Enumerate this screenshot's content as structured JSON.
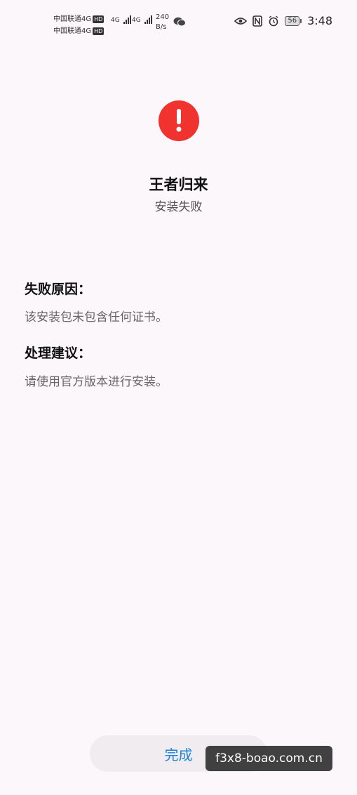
{
  "status_bar": {
    "carrier1": "中国联通4G",
    "carrier2": "中国联通4G",
    "hd_badge": "HD",
    "signal1_label": "4G",
    "signal2_label": "4G",
    "net_speed_value": "240",
    "net_speed_unit": "B/s",
    "battery_level": "56",
    "time": "3:48",
    "icons": [
      "wechat-icon",
      "eye-icon",
      "nfc-icon",
      "alarm-icon",
      "battery-icon"
    ]
  },
  "header": {
    "icon": "alert-icon",
    "icon_color": "#f0332f",
    "app_name": "王者归来",
    "install_status": "安装失败"
  },
  "failure_reason": {
    "title": "失败原因：",
    "text": "该安装包未包含任何证书。"
  },
  "suggestion": {
    "title": "处理建议：",
    "text": "请使用官方版本进行安装。"
  },
  "footer": {
    "done_label": "完成",
    "done_color": "#1a82d8"
  },
  "watermark": {
    "text": "f3x8-boao.com.cn"
  }
}
